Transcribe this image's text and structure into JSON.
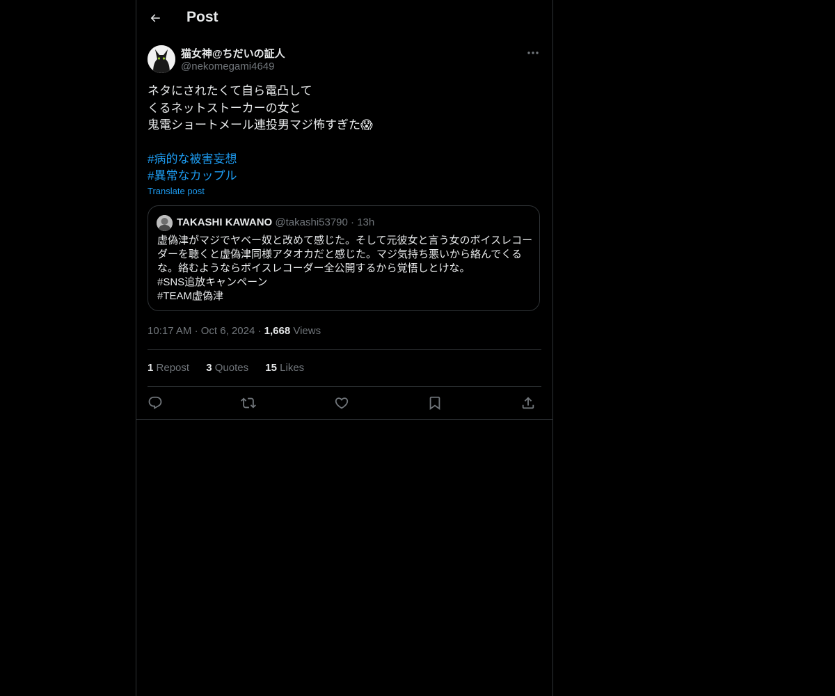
{
  "header": {
    "title": "Post"
  },
  "post": {
    "author_name": "猫女神@ちだいの証人",
    "author_handle": "@nekomegami4649",
    "text_lines": [
      "ネタにされたくて自ら電凸して",
      "くるネットストーカーの女と",
      "鬼電ショートメール連投男マジ怖すぎた😱"
    ],
    "hashtags": [
      "#病的な被害妄想",
      "#異常なカップル"
    ],
    "translate_label": "Translate post",
    "time": "10:17 AM",
    "date": "Oct 6, 2024",
    "views_count": "1,668",
    "views_label": "Views",
    "sep": "·"
  },
  "quote": {
    "name": "TAKASHI KAWANO",
    "handle": "@takashi53790",
    "sep": "·",
    "time": "13h",
    "lines": [
      "虚偽津がマジでヤベー奴と改めて感じた。そして元彼女と言う女のボイスレコー",
      "ダーを聴くと虚偽津同様アタオカだと感じた。マジ気持ち悪いから絡んでくる",
      "な。絡むようならボイスレコーダー全公開するから覚悟しとけな。",
      "#SNS追放キャンペーン",
      "#TEAM虚偽津"
    ]
  },
  "stats": {
    "reposts_count": "1",
    "reposts_label": "Repost",
    "quotes_count": "3",
    "quotes_label": "Quotes",
    "likes_count": "15",
    "likes_label": "Likes"
  },
  "icons": {
    "back": "arrow-left-icon",
    "more": "more-horizontal-icon",
    "reply": "reply-icon",
    "repost": "repost-icon",
    "like": "heart-icon",
    "bookmark": "bookmark-icon",
    "share": "share-icon"
  },
  "colors": {
    "background": "#000000",
    "text": "#e7e9ea",
    "muted": "#71767b",
    "accent": "#1d9bf0",
    "border": "#2f3336"
  }
}
